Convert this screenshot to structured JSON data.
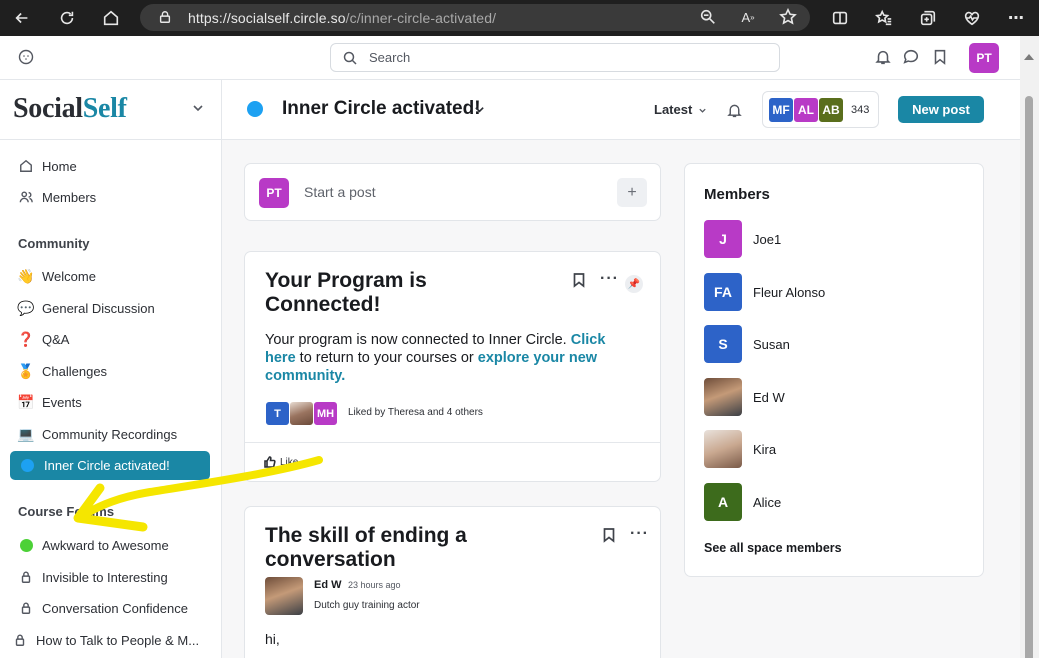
{
  "browser": {
    "url_host": "https://socialself.circle.so",
    "url_path": "/c/inner-circle-activated/"
  },
  "topbar": {
    "search_placeholder": "Search",
    "user_initials": "PT"
  },
  "sidebar": {
    "brand_part1": "Social",
    "brand_part2": "Self",
    "top_items": [
      {
        "label": "Home",
        "icon": "home-icon"
      },
      {
        "label": "Members",
        "icon": "members-icon"
      }
    ],
    "community_heading": "Community",
    "community_items": [
      {
        "label": "Welcome",
        "emoji": "👋"
      },
      {
        "label": "General Discussion",
        "emoji": "💬"
      },
      {
        "label": "Q&A",
        "emoji": "❓"
      },
      {
        "label": "Challenges",
        "emoji": "🏅"
      },
      {
        "label": "Events",
        "emoji": "📅"
      },
      {
        "label": "Community Recordings",
        "emoji": "💻"
      }
    ],
    "active_item": "Inner Circle activated!",
    "course_heading": "Course Forums",
    "course_items": [
      {
        "label": "Awkward to Awesome",
        "icon": "green-dot"
      },
      {
        "label": "Invisible to Interesting",
        "icon": "lock-icon"
      },
      {
        "label": "Conversation Confidence",
        "icon": "lock-icon"
      },
      {
        "label": "How to Talk to People & M...",
        "icon": "lock-icon"
      }
    ]
  },
  "header": {
    "space_title": "Inner Circle activated!",
    "sort_label": "Latest",
    "member_avatars": [
      {
        "initials": "MF",
        "color": "#2d63c8"
      },
      {
        "initials": "AL",
        "color": "#b83ac6"
      },
      {
        "initials": "AB",
        "color": "#5a6e1c"
      }
    ],
    "member_count": "343",
    "new_post_label": "New post"
  },
  "composer": {
    "initials": "PT",
    "placeholder": "Start a post",
    "plus": "+"
  },
  "post1": {
    "title": "Your Program is Connected!",
    "body_part1": "Your program is now connected to Inner Circle. ",
    "link1": "Click here",
    "body_part2": " to return to your courses or ",
    "link2": "explore your new community.",
    "likers": [
      {
        "initials": "T",
        "color": "#2d63c8"
      },
      {
        "initials": "",
        "color": "#9a7460"
      },
      {
        "initials": "MH",
        "color": "#b83ac6"
      }
    ],
    "liked_by": "Liked by Theresa and 4 others",
    "like_label": "Like"
  },
  "post2": {
    "title": "The skill of ending a conversation",
    "author": "Ed W",
    "time": "23 hours ago",
    "bio": "Dutch guy training actor",
    "body": "hi,"
  },
  "members_panel": {
    "title": "Members",
    "members": [
      {
        "initials": "J",
        "name": "Joe1",
        "color": "#b83ac6"
      },
      {
        "initials": "FA",
        "name": "Fleur Alonso",
        "color": "#2d63c8"
      },
      {
        "initials": "S",
        "name": "Susan",
        "color": "#2d63c8"
      },
      {
        "initials": "",
        "name": "Ed W",
        "color": "#8a6a55"
      },
      {
        "initials": "",
        "name": "Kira",
        "color": "#c9b3a5"
      },
      {
        "initials": "A",
        "name": "Alice",
        "color": "#3d6b1c"
      }
    ],
    "see_all": "See all space members"
  }
}
